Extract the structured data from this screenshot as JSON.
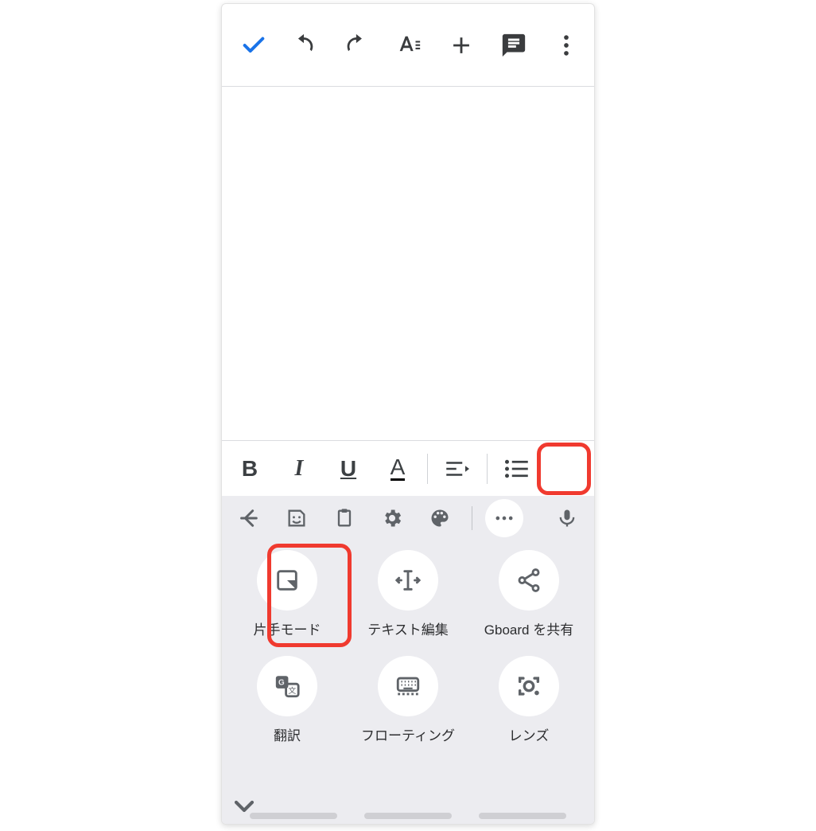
{
  "toolbar": {
    "icons": {
      "check": "check-icon",
      "undo": "undo-icon",
      "redo": "redo-icon",
      "textformat": "text-format-icon",
      "plus": "plus-icon",
      "comment": "comment-icon",
      "more": "more-vert-icon"
    }
  },
  "formatbar": {
    "bold_label": "B",
    "italic_label": "I",
    "underline_label": "U",
    "textcolor_label": "A",
    "align_icon": "align-icon",
    "list_icon": "bulleted-list-icon"
  },
  "keyboard": {
    "top_icons": {
      "back": "back-arrow-icon",
      "sticker": "sticker-icon",
      "clipboard": "clipboard-icon",
      "settings": "gear-icon",
      "palette": "palette-icon",
      "more": "more-horiz-icon",
      "mic": "mic-icon"
    },
    "items": [
      {
        "icon": "one-handed-icon",
        "label": "片手モード"
      },
      {
        "icon": "text-edit-icon",
        "label": "テキスト編集"
      },
      {
        "icon": "share-icon",
        "label": "Gboard を共有"
      },
      {
        "icon": "translate-icon",
        "label": "翻訳"
      },
      {
        "icon": "floating-keyboard-icon",
        "label": "フローティング"
      },
      {
        "icon": "lens-icon",
        "label": "レンズ"
      }
    ],
    "collapse_icon": "chevron-down-icon"
  }
}
